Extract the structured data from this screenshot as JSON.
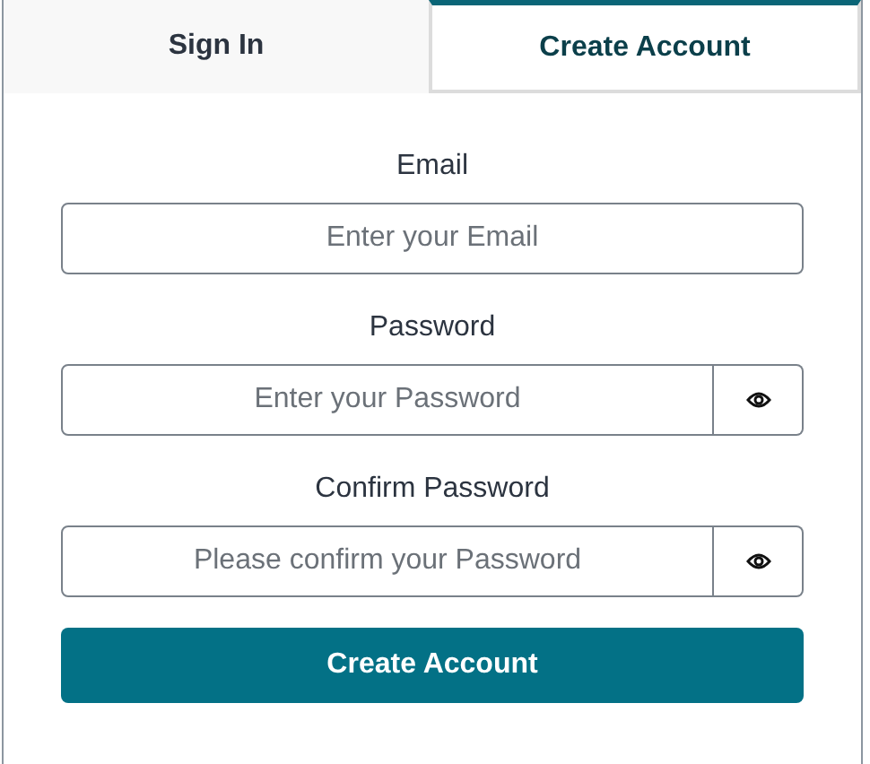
{
  "tabs": [
    {
      "label": "Sign In",
      "selected": false
    },
    {
      "label": "Create Account",
      "selected": true
    }
  ],
  "fields": [
    {
      "label": "Email",
      "placeholder": "Enter your Email",
      "kind": "text"
    },
    {
      "label": "Password",
      "placeholder": "Enter your Password",
      "kind": "password"
    },
    {
      "label": "Confirm Password",
      "placeholder": "Please confirm your Password",
      "kind": "password"
    }
  ],
  "submit": {
    "label": "Create Account"
  }
}
